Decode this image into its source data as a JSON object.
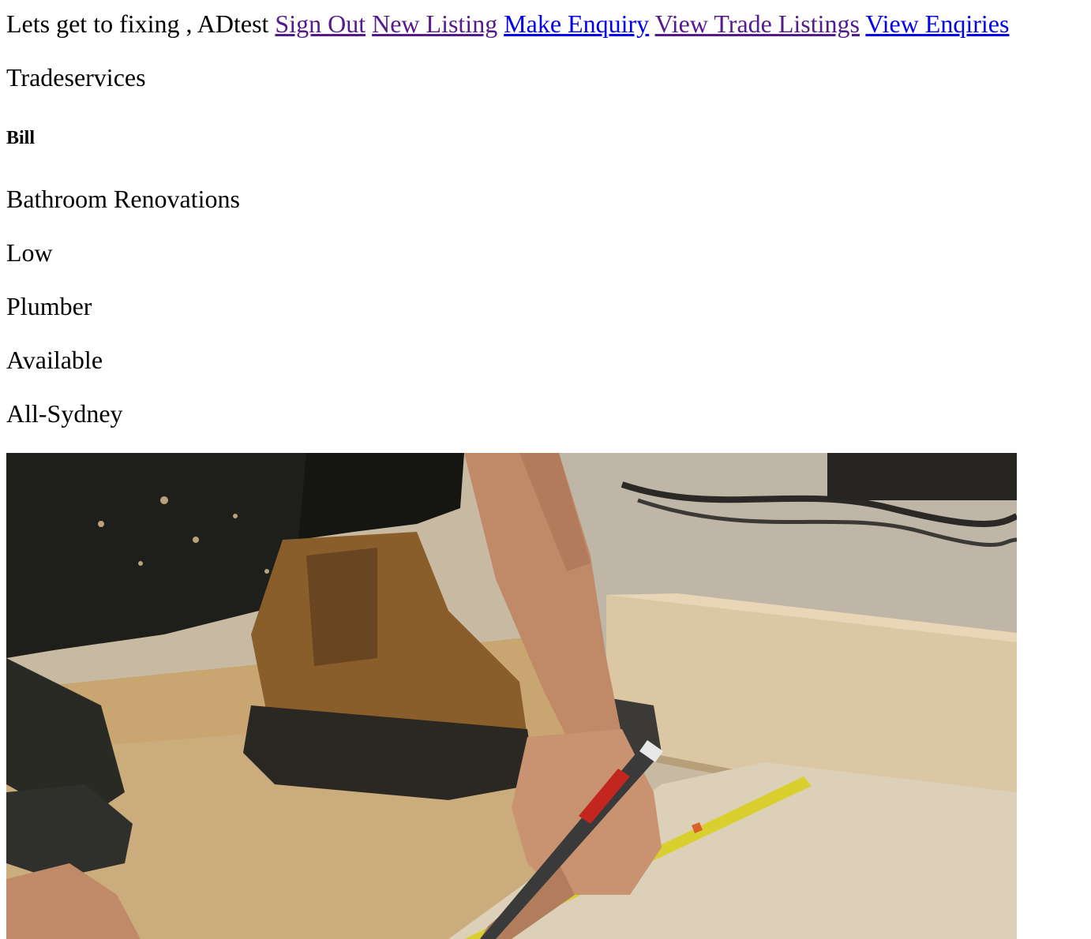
{
  "header": {
    "greeting": "Lets get to fixing , ADtest",
    "links": [
      {
        "label": "Sign Out",
        "state": "visited"
      },
      {
        "label": "New Listing",
        "state": "visited"
      },
      {
        "label": "Make Enquiry",
        "state": "unvisited"
      },
      {
        "label": "View Trade Listings",
        "state": "visited"
      },
      {
        "label": "View Enqiries",
        "state": "unvisited"
      }
    ]
  },
  "listing": {
    "heading": "Tradeservices",
    "owner": "Bill",
    "service": "Bathroom Renovations",
    "price": "Low",
    "trade": "Plumber",
    "availability": "Available",
    "area": "All-Sydney"
  },
  "photo": {
    "subject": "tradesman-measuring-timber",
    "colors": {
      "floor": "#c8b9a3",
      "chipboard": "#c9a571",
      "timber": "#dcc7a4",
      "boot": "#8a5e2b",
      "clothing": "#1e1f1a",
      "skin": "#c08a68",
      "tape": "#d9cf2f",
      "pencil_red": "#c2261f"
    }
  },
  "colors": {
    "link_visited": "#551A8B",
    "link_unvisited": "#0000EE",
    "text": "#000000",
    "background": "#ffffff"
  }
}
